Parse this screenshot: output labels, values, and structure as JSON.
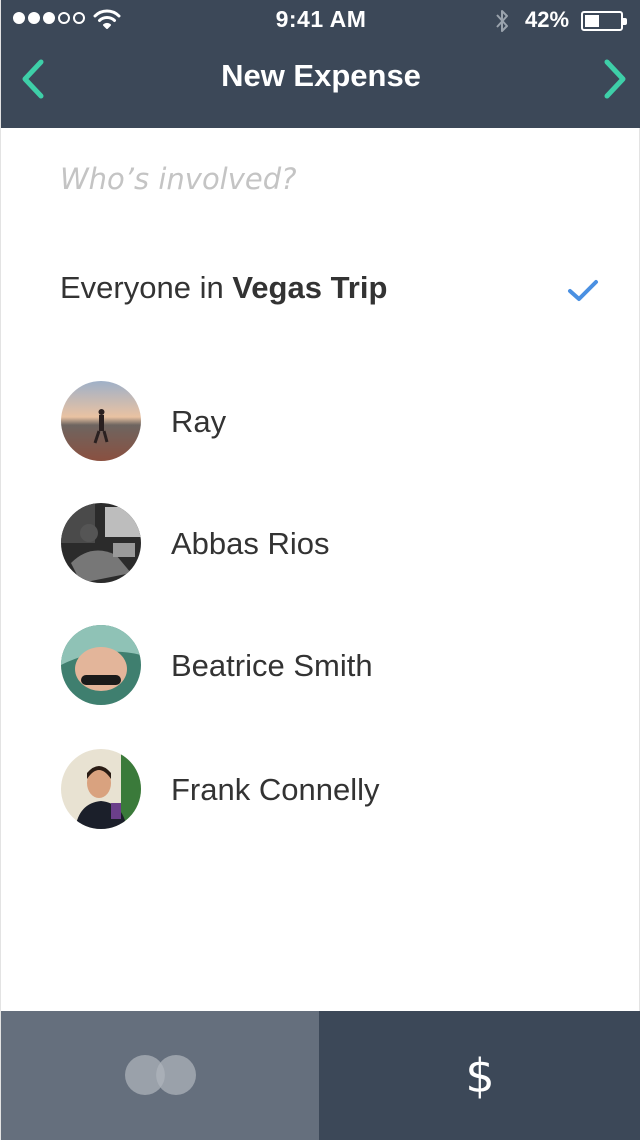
{
  "status_bar": {
    "time": "9:41 AM",
    "battery_percent": "42%",
    "battery_level": 0.42,
    "signal_bars_filled": 3,
    "signal_bars_total": 5,
    "icons": [
      "signal-dots-icon",
      "wifi-icon",
      "bluetooth-icon",
      "battery-icon"
    ]
  },
  "nav": {
    "title": "New Expense",
    "back_icon": "chevron-left-icon",
    "forward_icon": "chevron-right-icon",
    "accent_color": "#3ecfa8"
  },
  "prompt": "Who’s involved?",
  "everyone": {
    "prefix": "Everyone in ",
    "group_name": "Vegas Trip",
    "selected": true,
    "check_color": "#4a90e2"
  },
  "people": [
    {
      "name": "Ray"
    },
    {
      "name": "Abbas Rios"
    },
    {
      "name": "Beatrice Smith"
    },
    {
      "name": "Frank Connelly"
    }
  ],
  "bottom_tabs": {
    "split_icon": "split-circles-icon",
    "amount_label": "$"
  },
  "colors": {
    "header_bg": "#3c4858",
    "split_tab_bg": "#656f7d"
  }
}
